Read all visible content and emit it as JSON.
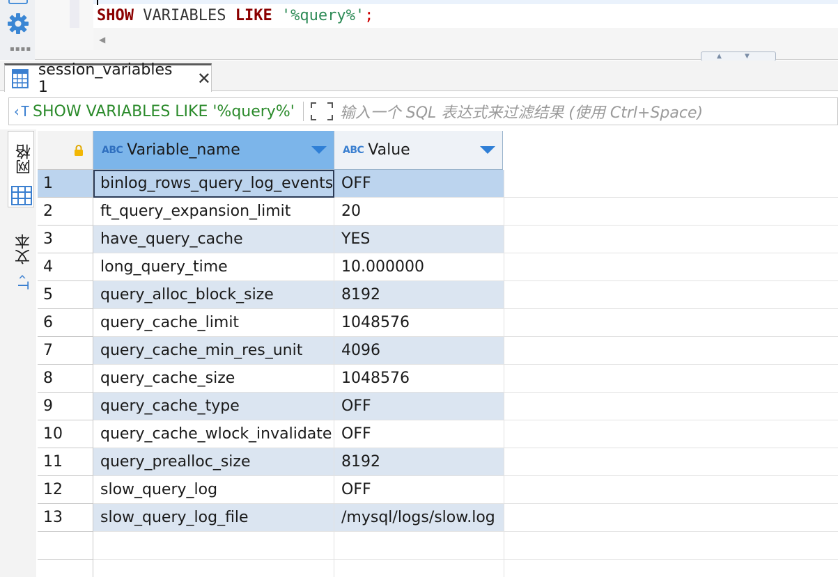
{
  "editor": {
    "sql_keyword_show": "SHOW",
    "sql_keyword_variables": "VARIABLES",
    "sql_keyword_like": "LIKE",
    "sql_string": "'%query%'",
    "sql_terminator": ";"
  },
  "results_tab": {
    "label": "session_variables 1",
    "close_glyph": "✕"
  },
  "filter": {
    "sql": "SHOW VARIABLES LIKE '%query%'",
    "placeholder": "输入一个 SQL 表达式来过滤结果 (使用 Ctrl+Space)"
  },
  "side_tabs": {
    "grid_label": "网格",
    "text_label": "文本"
  },
  "grid": {
    "columns": [
      {
        "type_badge": "ABC",
        "label": "Variable_name"
      },
      {
        "type_badge": "ABC",
        "label": "Value"
      }
    ],
    "rows": [
      {
        "num": "1",
        "name": "binlog_rows_query_log_events",
        "value": "OFF"
      },
      {
        "num": "2",
        "name": "ft_query_expansion_limit",
        "value": "20"
      },
      {
        "num": "3",
        "name": "have_query_cache",
        "value": "YES"
      },
      {
        "num": "4",
        "name": "long_query_time",
        "value": "10.000000"
      },
      {
        "num": "5",
        "name": "query_alloc_block_size",
        "value": "8192"
      },
      {
        "num": "6",
        "name": "query_cache_limit",
        "value": "1048576"
      },
      {
        "num": "7",
        "name": "query_cache_min_res_unit",
        "value": "4096"
      },
      {
        "num": "8",
        "name": "query_cache_size",
        "value": "1048576"
      },
      {
        "num": "9",
        "name": "query_cache_type",
        "value": "OFF"
      },
      {
        "num": "10",
        "name": "query_cache_wlock_invalidate",
        "value": "OFF"
      },
      {
        "num": "11",
        "name": "query_prealloc_size",
        "value": "8192"
      },
      {
        "num": "12",
        "name": "slow_query_log",
        "value": "OFF"
      },
      {
        "num": "13",
        "name": "slow_query_log_file",
        "value": "/mysql/logs/slow.log"
      }
    ],
    "selected_row": "1"
  },
  "icons": {
    "settings": "gear-icon",
    "tab": "grid-table-icon",
    "filter": "text-cursor-icon",
    "expand": "expand-icon",
    "lock": "lock-icon",
    "sort": "chevron-down-icon"
  },
  "colors": {
    "selected_header": "#7cb5ea",
    "alt_row": "#dbe5f1",
    "selected_row": "#bcd4ee",
    "sql_keyword": "#8b0000",
    "sql_string": "#2e8b57",
    "filter_sql": "#2a8a2a"
  }
}
